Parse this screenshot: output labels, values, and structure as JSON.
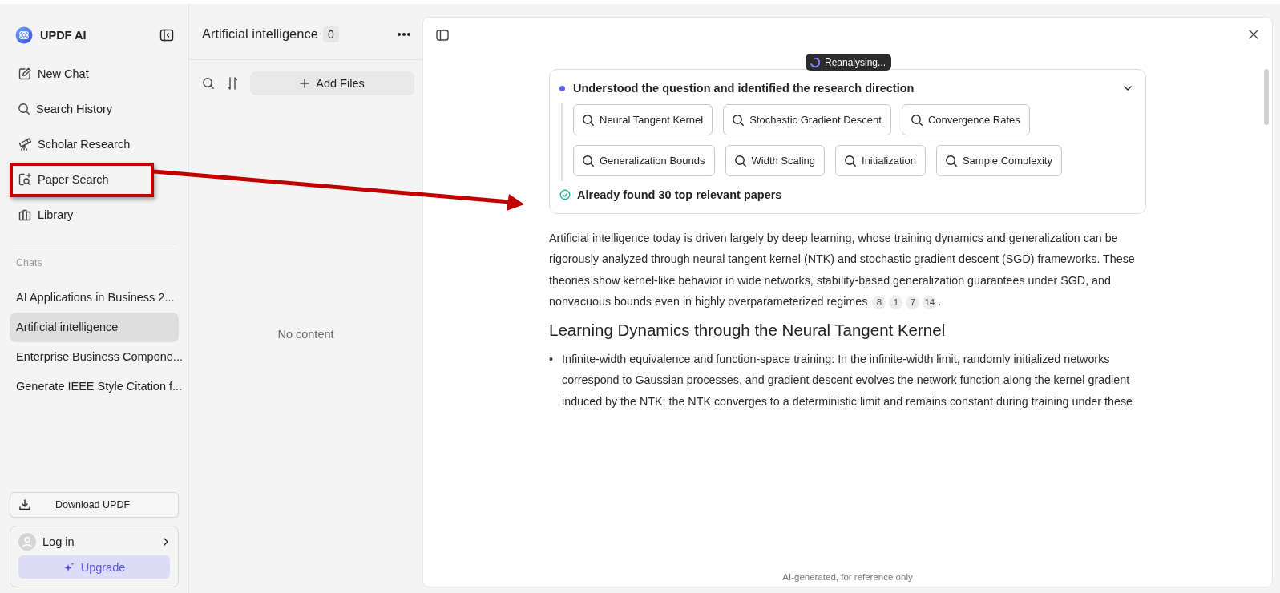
{
  "sidebar": {
    "brand": "UPDF AI",
    "nav": [
      {
        "label": "New Chat",
        "highlighted": false
      },
      {
        "label": "Search History",
        "highlighted": false
      },
      {
        "label": "Scholar Research",
        "highlighted": false
      },
      {
        "label": "Paper Search",
        "highlighted": true
      },
      {
        "label": "Library",
        "highlighted": false
      }
    ],
    "section_label": "Chats",
    "chats": [
      {
        "title": "AI Applications in Business 2...",
        "selected": false
      },
      {
        "title": "Artificial intelligence",
        "selected": true
      },
      {
        "title": "Enterprise Business Compone...",
        "selected": false
      },
      {
        "title": "Generate IEEE Style Citation f...",
        "selected": false
      }
    ],
    "download_button": "Download UPDF",
    "login": "Log in",
    "upgrade_button": "Upgrade"
  },
  "files_panel": {
    "title": "Artificial intelligence",
    "count": "0",
    "add_button": "Add Files",
    "empty_text": "No content"
  },
  "chat": {
    "status_badge": "Reanalysing...",
    "research": {
      "heading": "Understood the question and identified the research direction",
      "expanded": true,
      "keywords": [
        [
          "Neural Tangent Kernel",
          "Stochastic Gradient Descent",
          "Convergence Rates"
        ],
        [
          "Generalization Bounds",
          "Width Scaling",
          "Initialization",
          "Sample Complexity"
        ]
      ],
      "result": "Already found 30 top relevant papers"
    },
    "paragraph": {
      "text": "Artificial intelligence today is driven largely by deep learning, whose training dynamics and generalization can be rigorously analyzed through neural tangent kernel (NTK) and stochastic gradient descent (SGD) frameworks. These theories show kernel-like behavior in wide networks, stability-based generalization guarantees under SGD, and nonvacuous bounds even in highly overparameterized regimes",
      "citations": [
        "8",
        "1",
        "7",
        "14"
      ],
      "end": "."
    },
    "section_heading": "Learning Dynamics through the Neural Tangent Kernel",
    "bullets": [
      {
        "marker": "•",
        "text": "Infinite-width equivalence and function-space training: In the infinite-width limit, randomly initialized networks correspond to Gaussian processes, and gradient descent evolves the network function along the kernel gradient induced by the NTK; the NTK converges to a deterministic limit and remains constant during training under these"
      }
    ],
    "footer": "AI-generated, for reference only"
  }
}
